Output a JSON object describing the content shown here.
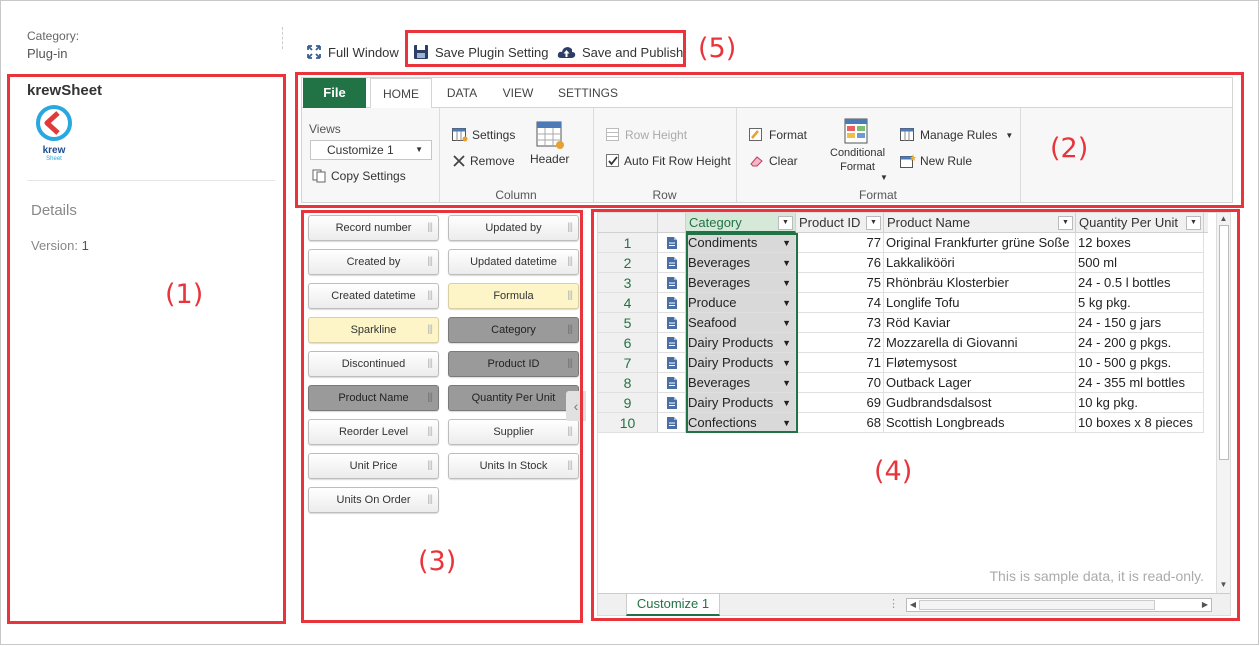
{
  "left_panel": {
    "category_label": "Category:",
    "category_value": "Plug-in",
    "app_name": "krewSheet",
    "logo_text": "krew",
    "logo_subtext": "Sheet",
    "details_label": "Details",
    "version_label": "Version:",
    "version_value": "1"
  },
  "top_toolbar": {
    "full_window": "Full Window",
    "save_plugin_setting": "Save Plugin Setting",
    "save_and_publish": "Save and Publish"
  },
  "callouts": [
    "(1)",
    "(2)",
    "(3)",
    "(4)",
    "(5)"
  ],
  "ribbon": {
    "tabs": [
      "File",
      "HOME",
      "DATA",
      "VIEW",
      "SETTINGS"
    ],
    "views_label": "Views",
    "views_selected": "Customize 1",
    "copy_settings": "Copy Settings",
    "column_group": {
      "label": "Column",
      "settings": "Settings",
      "remove": "Remove",
      "header": "Header"
    },
    "row_group": {
      "label": "Row",
      "row_height": "Row Height",
      "auto_fit": "Auto Fit Row Height",
      "auto_fit_checked": true
    },
    "format_group": {
      "label": "Format",
      "format": "Format",
      "clear": "Clear",
      "conditional_format_1": "Conditional",
      "conditional_format_2": "Format",
      "manage_rules": "Manage Rules",
      "new_rule": "New Rule"
    }
  },
  "fields": [
    {
      "label": "Record number",
      "style": "normal"
    },
    {
      "label": "Updated by",
      "style": "normal"
    },
    {
      "label": "Created by",
      "style": "normal"
    },
    {
      "label": "Updated datetime",
      "style": "normal"
    },
    {
      "label": "Created datetime",
      "style": "normal"
    },
    {
      "label": "Formula",
      "style": "yellow"
    },
    {
      "label": "Sparkline",
      "style": "yellow"
    },
    {
      "label": "Category",
      "style": "dark"
    },
    {
      "label": "Discontinued",
      "style": "normal"
    },
    {
      "label": "Product ID",
      "style": "dark"
    },
    {
      "label": "Product Name",
      "style": "dark"
    },
    {
      "label": "Quantity Per Unit",
      "style": "dark"
    },
    {
      "label": "Reorder Level",
      "style": "normal"
    },
    {
      "label": "Supplier",
      "style": "normal"
    },
    {
      "label": "Unit Price",
      "style": "normal"
    },
    {
      "label": "Units In Stock",
      "style": "normal"
    },
    {
      "label": "Units On Order",
      "style": "normal"
    }
  ],
  "grid": {
    "columns": [
      "Category",
      "Product ID",
      "Product Name",
      "Quantity Per Unit"
    ],
    "rows": [
      {
        "n": "1",
        "category": "Condiments",
        "id": "77",
        "name": "Original Frankfurter grüne Soße",
        "qty": "12 boxes"
      },
      {
        "n": "2",
        "category": "Beverages",
        "id": "76",
        "name": "Lakkalikööri",
        "qty": "500 ml"
      },
      {
        "n": "3",
        "category": "Beverages",
        "id": "75",
        "name": "Rhönbräu Klosterbier",
        "qty": "24 - 0.5 l bottles"
      },
      {
        "n": "4",
        "category": "Produce",
        "id": "74",
        "name": "Longlife Tofu",
        "qty": "5 kg pkg."
      },
      {
        "n": "5",
        "category": "Seafood",
        "id": "73",
        "name": "Röd Kaviar",
        "qty": "24 - 150 g jars"
      },
      {
        "n": "6",
        "category": "Dairy Products",
        "id": "72",
        "name": "Mozzarella di Giovanni",
        "qty": "24 - 200 g pkgs."
      },
      {
        "n": "7",
        "category": "Dairy Products",
        "id": "71",
        "name": "Fløtemysost",
        "qty": "10 - 500 g pkgs."
      },
      {
        "n": "8",
        "category": "Beverages",
        "id": "70",
        "name": "Outback Lager",
        "qty": "24 - 355 ml bottles"
      },
      {
        "n": "9",
        "category": "Dairy Products",
        "id": "69",
        "name": "Gudbrandsdalsost",
        "qty": "10 kg pkg."
      },
      {
        "n": "10",
        "category": "Confections",
        "id": "68",
        "name": "Scottish Longbreads",
        "qty": "10 boxes x 8 pieces"
      }
    ],
    "readonly_note": "This is sample data, it is read-only.",
    "sheet_tab": "Customize 1"
  },
  "colors": {
    "accent_green": "#217346",
    "callout_red": "#e8343a"
  }
}
